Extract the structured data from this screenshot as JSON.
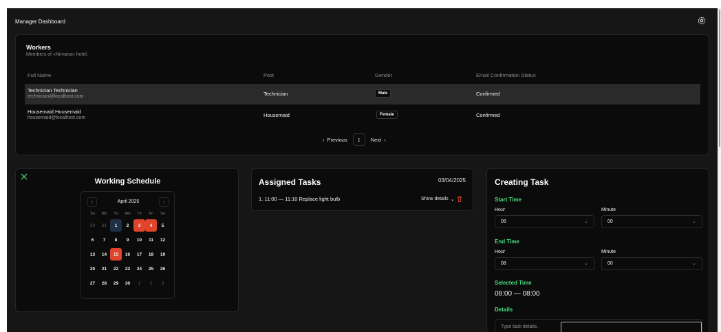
{
  "app": {
    "title": "Manager Dashboard",
    "settings_icon": "gear-icon"
  },
  "workers": {
    "title": "Workers",
    "subtitle": "Members of «Nirvana» hotel.",
    "columns": [
      "Full Name",
      "Post",
      "Gender",
      "Email Confirmation Status"
    ],
    "rows": [
      {
        "name": "Technician Technician",
        "email": "technician@localhost.com",
        "post": "Technician",
        "gender": "Male",
        "status": "Confirmed"
      },
      {
        "name": "Housemaid Housemaid",
        "email": "housemaid@localhost.com",
        "post": "Housemaid",
        "gender": "Female",
        "status": "Confirmed"
      }
    ],
    "pagination": {
      "previous": "Previous",
      "page": "1",
      "next": "Next"
    }
  },
  "schedule": {
    "title": "Working Schedule",
    "month": "April 2025",
    "weekdays": [
      "Su",
      "Mo",
      "Tu",
      "We",
      "Th",
      "Fr",
      "Sa"
    ],
    "days": [
      {
        "d": "30",
        "s": "muted"
      },
      {
        "d": "31",
        "s": "muted"
      },
      {
        "d": "1",
        "s": "today"
      },
      {
        "d": "2",
        "s": ""
      },
      {
        "d": "3",
        "s": "busy"
      },
      {
        "d": "4",
        "s": "busy"
      },
      {
        "d": "5",
        "s": ""
      },
      {
        "d": "6",
        "s": ""
      },
      {
        "d": "7",
        "s": ""
      },
      {
        "d": "8",
        "s": ""
      },
      {
        "d": "9",
        "s": ""
      },
      {
        "d": "10",
        "s": ""
      },
      {
        "d": "11",
        "s": ""
      },
      {
        "d": "12",
        "s": ""
      },
      {
        "d": "13",
        "s": ""
      },
      {
        "d": "14",
        "s": ""
      },
      {
        "d": "15",
        "s": "busy"
      },
      {
        "d": "16",
        "s": ""
      },
      {
        "d": "17",
        "s": ""
      },
      {
        "d": "18",
        "s": ""
      },
      {
        "d": "19",
        "s": ""
      },
      {
        "d": "20",
        "s": ""
      },
      {
        "d": "21",
        "s": ""
      },
      {
        "d": "22",
        "s": ""
      },
      {
        "d": "23",
        "s": ""
      },
      {
        "d": "24",
        "s": ""
      },
      {
        "d": "25",
        "s": ""
      },
      {
        "d": "26",
        "s": ""
      },
      {
        "d": "27",
        "s": ""
      },
      {
        "d": "28",
        "s": ""
      },
      {
        "d": "29",
        "s": ""
      },
      {
        "d": "30",
        "s": ""
      },
      {
        "d": "1",
        "s": "muted"
      },
      {
        "d": "2",
        "s": "muted"
      },
      {
        "d": "3",
        "s": "muted"
      }
    ],
    "colors": {
      "today": "#1f2f45",
      "busy": "#e0452b"
    }
  },
  "assigned": {
    "title": "Assigned Tasks",
    "date": "03/04/2025",
    "tasks": [
      {
        "text": "1.  11:00 — 11:10  Replace light bulb",
        "action": "Show details"
      }
    ]
  },
  "creating": {
    "title": "Creating Task",
    "start_label": "Start Time",
    "end_label": "End Time",
    "hour_label": "Hour",
    "minute_label": "Minute",
    "start_hour": "08",
    "start_minute": "00",
    "end_hour": "08",
    "end_minute": "00",
    "selected_label": "Selected Time",
    "selected_value": "08:00 — 08:00",
    "details_label": "Details",
    "details_placeholder": "Type task details.",
    "accent": "#4ade80"
  }
}
